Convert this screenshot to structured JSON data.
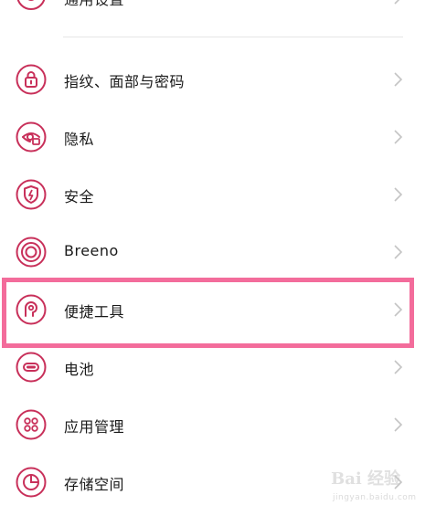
{
  "theme": {
    "accent": "#c8305a",
    "highlight": "#f36c9b",
    "chevron": "#c4c4c4"
  },
  "partial_item": {
    "icon": "settings-icon",
    "label": "通用设置"
  },
  "items": [
    {
      "icon": "lock-icon",
      "label": "指纹、面部与密码"
    },
    {
      "icon": "privacy-eye-icon",
      "label": "隐私"
    },
    {
      "icon": "security-shield-icon",
      "label": "安全"
    },
    {
      "icon": "breeno-icon",
      "label": "Breeno"
    },
    {
      "icon": "shortcut-tools-icon",
      "label": "便捷工具"
    },
    {
      "icon": "battery-icon",
      "label": "电池"
    },
    {
      "icon": "apps-icon",
      "label": "应用管理"
    },
    {
      "icon": "storage-icon",
      "label": "存储空间"
    }
  ],
  "watermark": {
    "main": "Bai 经验",
    "sub": "jingyan.baidu.com"
  }
}
